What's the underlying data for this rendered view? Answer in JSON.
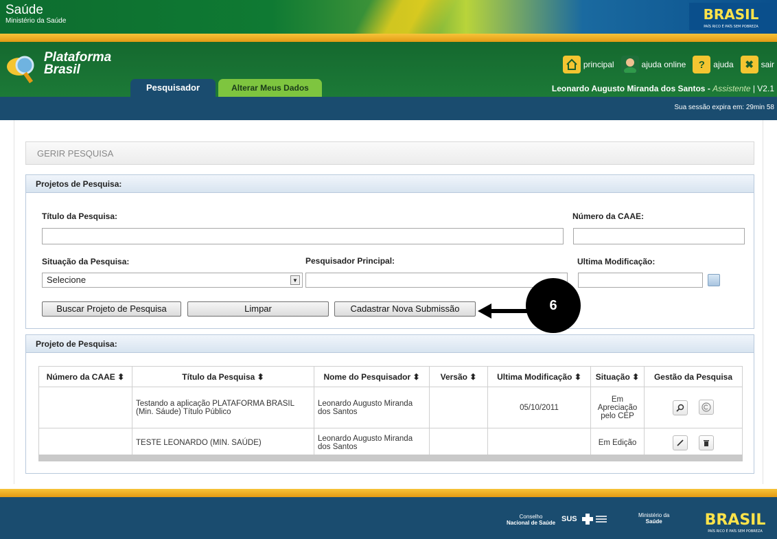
{
  "gov": {
    "saude": "Saúde",
    "ministerio": "Ministério da Saúde",
    "brasil": "BRASIL",
    "brasil_tag": "PAÍS RICO É PAÍS SEM POBREZA"
  },
  "header": {
    "logo_line1": "Plataforma",
    "logo_line2": "Brasil",
    "tabs": [
      {
        "label": "Pesquisador"
      },
      {
        "label": "Alterar Meus Dados"
      }
    ],
    "links": [
      {
        "label": "principal"
      },
      {
        "label": "ajuda online"
      },
      {
        "label": "ajuda"
      },
      {
        "label": "sair"
      }
    ],
    "user_name": "Leonardo Augusto Miranda dos Santos",
    "user_sep": " - ",
    "user_role": "Assistente",
    "version": " | V2.1",
    "session": "Sua sessão expira em: 29min 58"
  },
  "page": {
    "title": "GERIR PESQUISA"
  },
  "search": {
    "section_title": "Projetos de Pesquisa:",
    "titulo_label": "Título da Pesquisa:",
    "titulo_value": "",
    "caae_label": "Número da CAAE:",
    "caae_value": "",
    "situacao_label": "Situação da Pesquisa:",
    "situacao_value": "Selecione",
    "pesquisador_label": "Pesquisador Principal:",
    "pesquisador_value": "",
    "modificacao_label": "Ultima Modificação:",
    "modificacao_value": "",
    "btn_buscar": "Buscar Projeto de Pesquisa",
    "btn_limpar": "Limpar",
    "btn_cadastrar": "Cadastrar Nova Submissão"
  },
  "callout": {
    "number": "6"
  },
  "results": {
    "section_title": "Projeto de Pesquisa:",
    "columns": [
      "Número da CAAE ⬍",
      "Título da Pesquisa ⬍",
      "Nome do Pesquisador ⬍",
      "Versão ⬍",
      "Ultima Modificação ⬍",
      "Situação ⬍",
      "Gestão da Pesquisa"
    ],
    "rows": [
      {
        "caae": "",
        "titulo": "Testando a aplicação PLATAFORMA BRASIL (Min. Sáude) Título Público",
        "pesquisador": "Leonardo Augusto Miranda dos Santos",
        "versao": "",
        "modificacao": "05/10/2011",
        "situacao": "Em Apreciação pelo CEP"
      },
      {
        "caae": "",
        "titulo": "TESTE LEONARDO (MIN. SAÚDE)",
        "pesquisador": "Leonardo Augusto Miranda dos Santos",
        "versao": "",
        "modificacao": "",
        "situacao": "Em Edição"
      }
    ]
  },
  "footer": {
    "cns_line1": "Conselho",
    "cns_line2": "Nacional de Saúde",
    "sus": "SUS",
    "min_line1": "Ministério da",
    "min_line2": "Saúde"
  },
  "colors": {
    "green": "#1c7a37",
    "navy": "#1a4c6f",
    "gold": "#f4c531",
    "tab_green": "#7ec53f"
  }
}
